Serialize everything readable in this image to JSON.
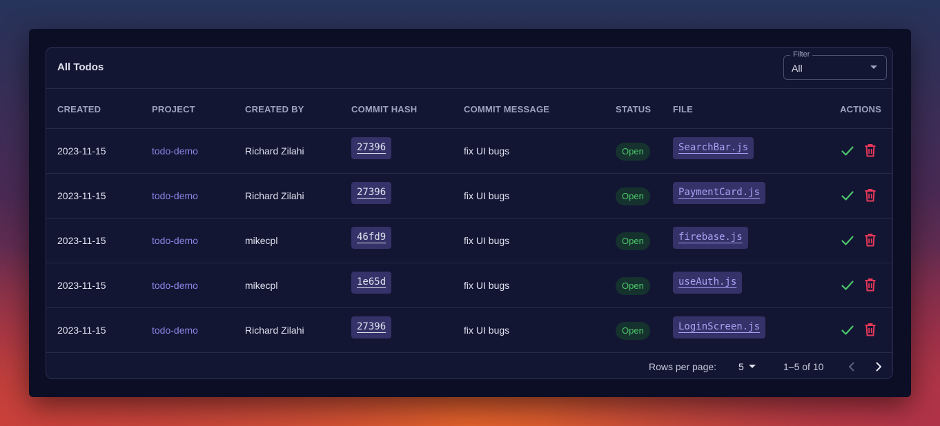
{
  "card": {
    "title": "All Todos",
    "filter": {
      "label": "Filter",
      "value": "All"
    }
  },
  "table": {
    "columns": [
      "CREATED",
      "PROJECT",
      "CREATED BY",
      "COMMIT HASH",
      "COMMIT MESSAGE",
      "STATUS",
      "FILE",
      "ACTIONS"
    ],
    "rows": [
      {
        "created": "2023-11-15",
        "project": "todo-demo",
        "created_by": "Richard Zilahi",
        "commit_hash": "27396",
        "commit_message": "fix UI bugs",
        "status": "Open",
        "file": "SearchBar.js"
      },
      {
        "created": "2023-11-15",
        "project": "todo-demo",
        "created_by": "Richard Zilahi",
        "commit_hash": "27396",
        "commit_message": "fix UI bugs",
        "status": "Open",
        "file": "PaymentCard.js"
      },
      {
        "created": "2023-11-15",
        "project": "todo-demo",
        "created_by": "mikecpl",
        "commit_hash": "46fd9",
        "commit_message": "fix UI bugs",
        "status": "Open",
        "file": "firebase.js"
      },
      {
        "created": "2023-11-15",
        "project": "todo-demo",
        "created_by": "mikecpl",
        "commit_hash": "1e65d",
        "commit_message": "fix UI bugs",
        "status": "Open",
        "file": "useAuth.js"
      },
      {
        "created": "2023-11-15",
        "project": "todo-demo",
        "created_by": "Richard Zilahi",
        "commit_hash": "27396",
        "commit_message": "fix UI bugs",
        "status": "Open",
        "file": "LoginScreen.js"
      }
    ]
  },
  "pagination": {
    "rows_per_page_label": "Rows per page:",
    "rows_per_page_value": "5",
    "range_text": "1–5 of 10"
  },
  "icons": {
    "complete": "check-icon",
    "delete": "trash-icon",
    "prev": "chevron-left-icon",
    "next": "chevron-right-icon",
    "dropdown": "caret-down-icon"
  },
  "colors": {
    "accent": "#8c86e6",
    "status_open_text": "#4cc86a",
    "check": "#4cc86a",
    "delete": "#e8385a"
  }
}
